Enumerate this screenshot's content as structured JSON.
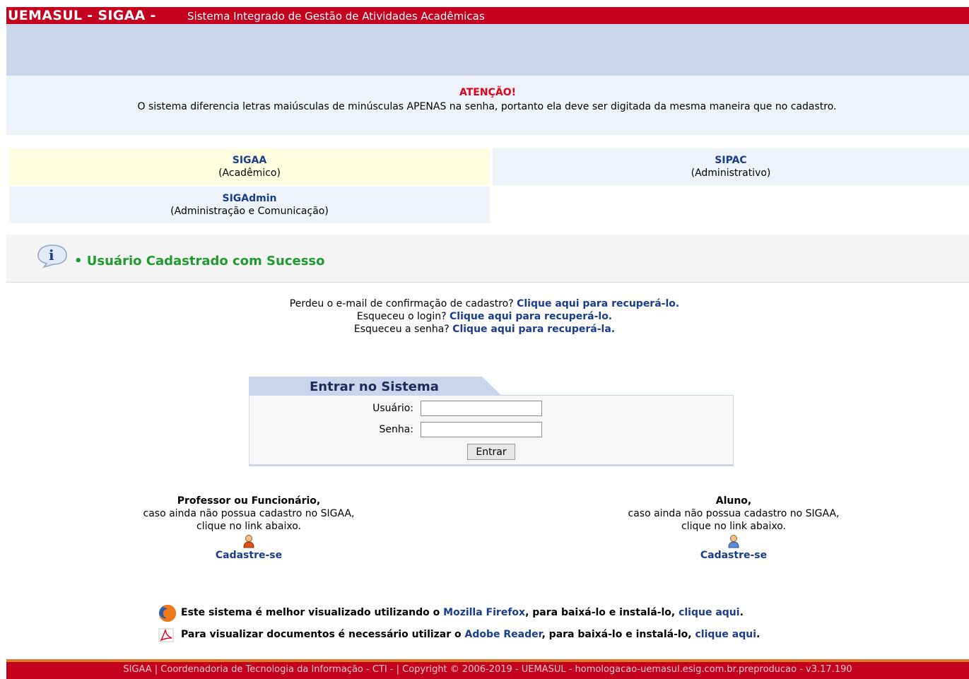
{
  "header": {
    "brand": "UEMASUL - SIGAA -",
    "subtitle": "Sistema Integrado de Gestão de Atividades Acadêmicas"
  },
  "attention": {
    "title": "ATENÇÃO!",
    "message": "O sistema diferencia letras maiúsculas de minúsculas APENAS na senha, portanto ela deve ser digitada da mesma maneira que no cadastro."
  },
  "systems": {
    "sigaa": {
      "name": "SIGAA",
      "desc": "(Acadêmico)"
    },
    "sipac": {
      "name": "SIPAC",
      "desc": "(Administrativo)"
    },
    "sigadmin": {
      "name": "SIGAdmin",
      "desc": "(Administração e Comunicação)"
    }
  },
  "success": {
    "message": "Usuário Cadastrado com Sucesso"
  },
  "recover": {
    "email_text": "Perdeu o e-mail de confirmação de cadastro?",
    "email_link": "Clique aqui para recuperá-lo.",
    "login_text": "Esqueceu o login?",
    "login_link": "Clique aqui para recuperá-lo.",
    "password_text": "Esqueceu a senha?",
    "password_link": "Clique aqui para recuperá-la."
  },
  "login": {
    "title": "Entrar no Sistema",
    "user_label": "Usuário:",
    "user_value": "",
    "password_label": "Senha:",
    "password_value": "",
    "submit_label": "Entrar"
  },
  "register": {
    "professor": {
      "heading": "Professor ou Funcionário,",
      "line1": "caso ainda não possua cadastro no SIGAA,",
      "line2": "clique no link abaixo.",
      "link": "Cadastre-se",
      "icon": "user-orange-icon"
    },
    "student": {
      "heading": "Aluno,",
      "line1": "caso ainda não possua cadastro no SIGAA,",
      "line2": "clique no link abaixo.",
      "link": "Cadastre-se",
      "icon": "user-blue-icon"
    }
  },
  "tips": {
    "firefox": {
      "text_before": "Este sistema é melhor visualizado utilizando o",
      "link_product": "Mozilla Firefox",
      "text_mid": ", para baixá-lo e instalá-lo,",
      "link_action": "clique aqui",
      "text_end": "."
    },
    "adobe": {
      "text_before": "Para visualizar documentos é necessário utilizar o",
      "link_product": "Adobe Reader",
      "text_mid": ", para baixá-lo e instalá-lo,",
      "link_action": "clique aqui",
      "text_end": "."
    }
  },
  "footer": {
    "text": "SIGAA | Coordenadoria de Tecnologia da Informação - CTI - | Copyright © 2006-2019 - UEMASUL - homologacao-uemasul.esig.com.br.preproducao - v3.17.190"
  },
  "colors": {
    "header_red": "#c4001f",
    "link_blue": "#1a3c8f",
    "attention_red": "#e0001a",
    "success_green": "#1f9a2e"
  }
}
